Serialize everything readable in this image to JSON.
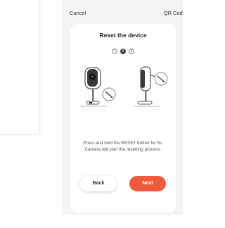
{
  "header": {
    "cancel_label": "Cancel",
    "qr_label": "QR Code"
  },
  "card": {
    "title": "Reset the device",
    "steps": [
      "1",
      "2",
      "3"
    ],
    "active_step": 2,
    "instruction": "Press and hold the RESET button for 5s. Camera will start the resetting process."
  },
  "buttons": {
    "back_label": "Back",
    "next_label": "Next"
  },
  "colors": {
    "accent": "#ef5a3c",
    "background": "#f4f4f4",
    "card": "#ffffff"
  },
  "icons": {
    "camera_front": "camera-front-icon",
    "camera_side": "camera-side-icon",
    "reset_pin": "reset-pin-icon"
  }
}
